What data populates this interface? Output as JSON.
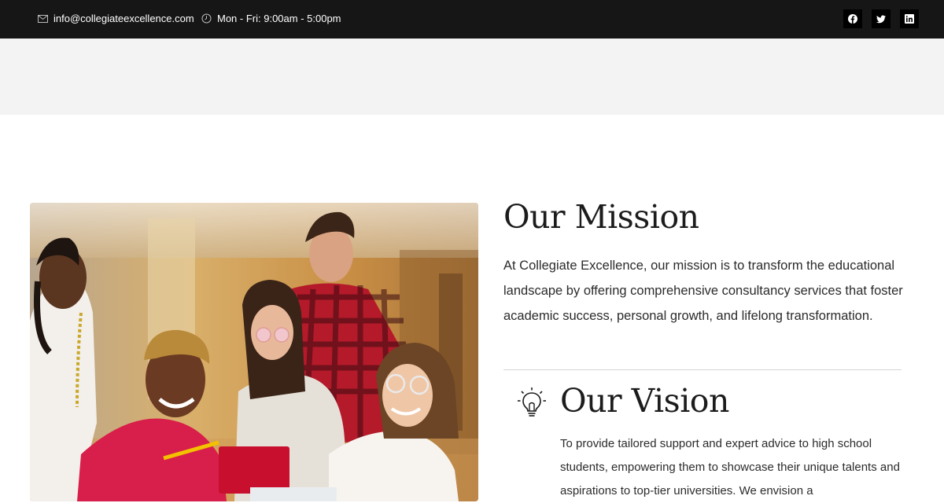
{
  "topbar": {
    "email": "info@collegiateexcellence.com",
    "hours": "Mon - Fri: 9:00am - 5:00pm",
    "social": [
      {
        "icon": "facebook-icon"
      },
      {
        "icon": "twitter-icon"
      },
      {
        "icon": "linkedin-icon"
      }
    ]
  },
  "mission": {
    "title": "Our Mission",
    "text": "At Collegiate Excellence, our mission is to transform the educational landscape by offering comprehensive consultancy services that foster academic success, personal growth, and lifelong transformation."
  },
  "vision": {
    "icon": "lightbulb-icon",
    "title": "Our Vision",
    "text": "To provide tailored support and expert advice to high school students, empowering them to showcase their unique talents and aspirations to top-tier universities. We envision a"
  },
  "colors": {
    "topbar_bg": "#161616",
    "band_bg": "#f3f3f3",
    "heading": "#1c1c1c",
    "body_text": "#2b2b2b"
  }
}
